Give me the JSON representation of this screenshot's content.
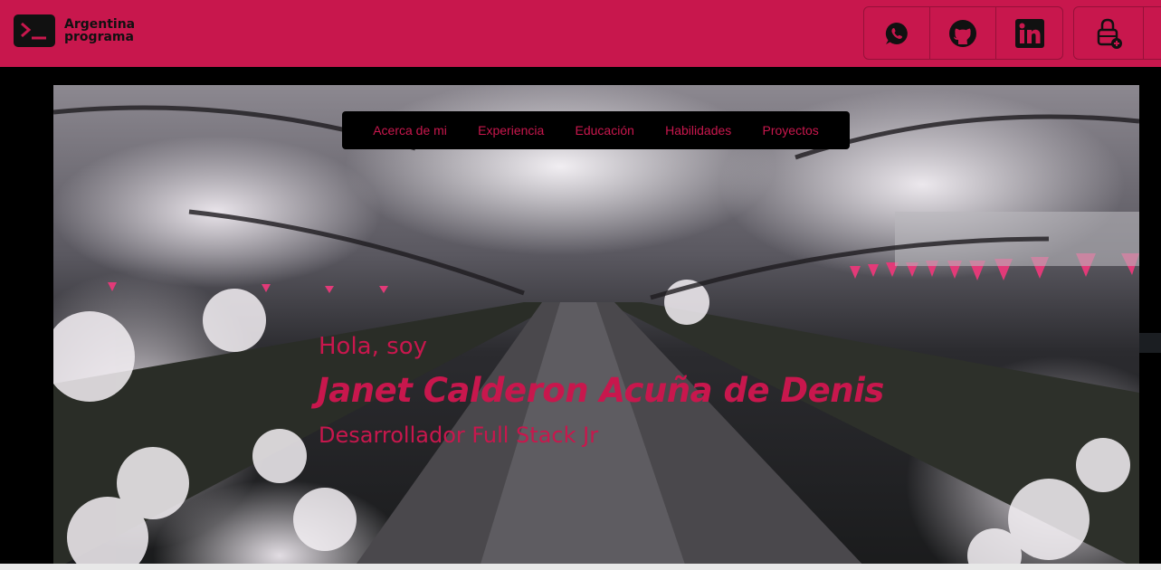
{
  "brand": {
    "line1": "Argentina",
    "line2": "programa",
    "logo_icon": "terminal-icon"
  },
  "header": {
    "background": "#c8174d",
    "social": [
      {
        "name": "whatsapp",
        "icon": "whatsapp-icon"
      },
      {
        "name": "github",
        "icon": "github-icon"
      },
      {
        "name": "linkedin",
        "icon": "linkedin-icon"
      }
    ],
    "login_icon": "lock-add-icon"
  },
  "nav": {
    "items": [
      "Acerca de mi",
      "Experiencia",
      "Educación",
      "Habilidades",
      "Proyectos"
    ]
  },
  "hero": {
    "greeting": "Hola, soy",
    "name": "Janet Calderon Acuña de Denis",
    "role": "Desarrollador Full Stack Jr",
    "accent": "#c8174d",
    "image": "cherry-blossom-canal-photo"
  }
}
